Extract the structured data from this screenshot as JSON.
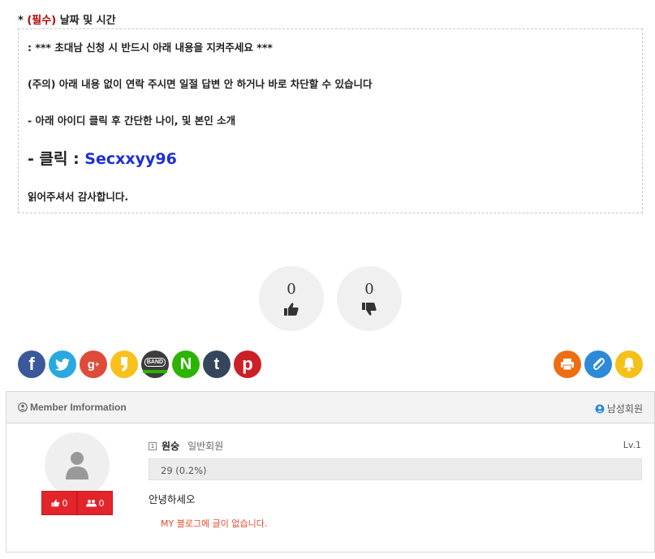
{
  "field": {
    "star": "*",
    "required": "(필수)",
    "label": "날짜 및 시간"
  },
  "notice": {
    "line1": ": *** 초대남 신청 시 반드시 아래 내용을 지켜주세요 ***",
    "line2": "(주의) 아래 내용 없이 연락 주시면 일절 답변 안 하거나 바로 차단할 수 있습니다",
    "line3": "- 아래 아이디 클릭 후 간단한 나이, 및 본인 소개",
    "line4_prefix": "- 클릭 : ",
    "line4_id": "Secxxyy96",
    "line5": "읽어주셔서 감사합니다."
  },
  "votes": {
    "up": "0",
    "down": "0"
  },
  "share": {
    "icons": [
      "facebook-icon",
      "twitter-icon",
      "google-plus-icon",
      "kakaostory-icon",
      "band-icon",
      "naver-icon",
      "tumblr-icon",
      "pinterest-icon"
    ],
    "band_text": "BAND",
    "actions": [
      "print-icon",
      "clip-icon",
      "bell-icon"
    ],
    "colors": {
      "facebook": "#3b5998",
      "twitter": "#29a9e0",
      "google": "#dd4b39",
      "kakaostory": "#f9c11a",
      "naver": "#2db400",
      "tumblr": "#35465c",
      "pinterest": "#cb2027",
      "print": "#ef6d12",
      "clip": "#2d8ad8",
      "bell": "#f5c119"
    }
  },
  "member": {
    "title": "Member Imformation",
    "gender": "남성회원",
    "level_icon": "1",
    "name": "원숭",
    "grade": "일반회원",
    "level": "Lv.1",
    "exp": "29 (0.2%)",
    "greeting": "안녕하세오",
    "blog_empty": "MY 블로그에 글이 없습니다.",
    "likes": "0",
    "friends": "0"
  }
}
